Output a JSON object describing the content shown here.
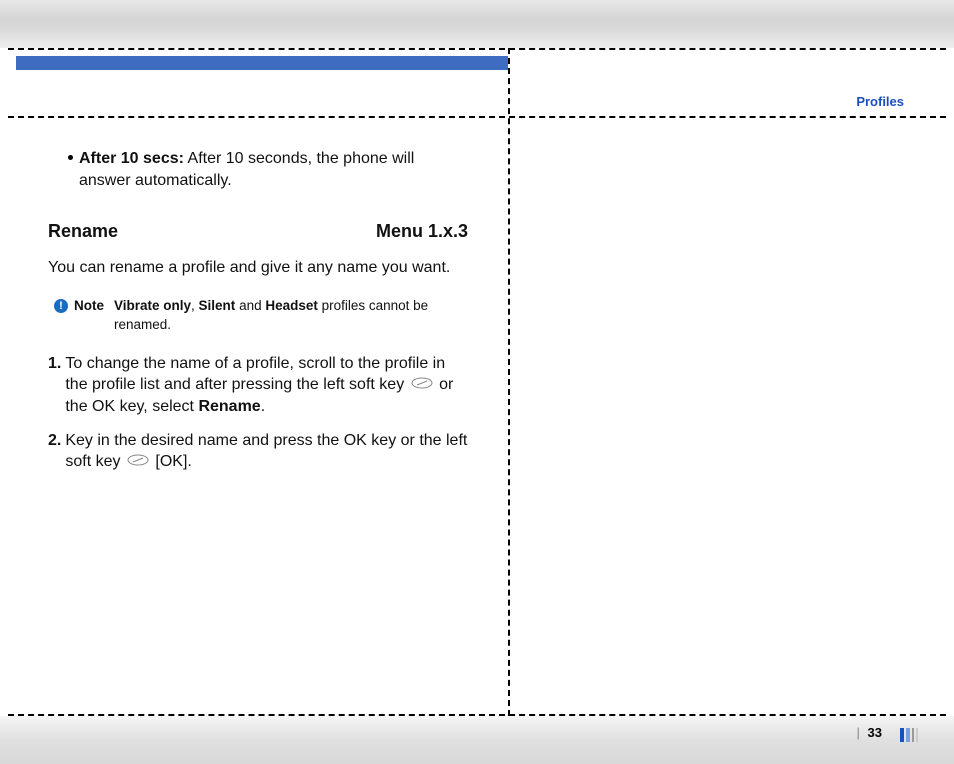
{
  "header": {
    "section": "Profiles"
  },
  "bullet": {
    "label": "After 10 secs:",
    "text": " After 10 seconds, the phone will answer automatically."
  },
  "heading": {
    "title": "Rename",
    "menu": "Menu 1.x.3"
  },
  "intro": "You can rename a profile and give it any name you want.",
  "note": {
    "icon": "!",
    "label": "Note",
    "b1": "Vibrate only",
    "sep1": ", ",
    "b2": "Silent",
    "sep2": " and ",
    "b3": "Headset",
    "tail": " profiles cannot be renamed."
  },
  "step1": {
    "num": "1.",
    "t1": " To change the name of a profile, scroll to the profile in the profile list and after pressing the left soft key ",
    "t2": " or the OK key, select ",
    "bold": "Rename",
    "t3": "."
  },
  "step2": {
    "num": "2.",
    "t1": " Key in the desired name and press the OK key or the left soft key ",
    "t2": " [OK]."
  },
  "page": {
    "num": "33"
  }
}
